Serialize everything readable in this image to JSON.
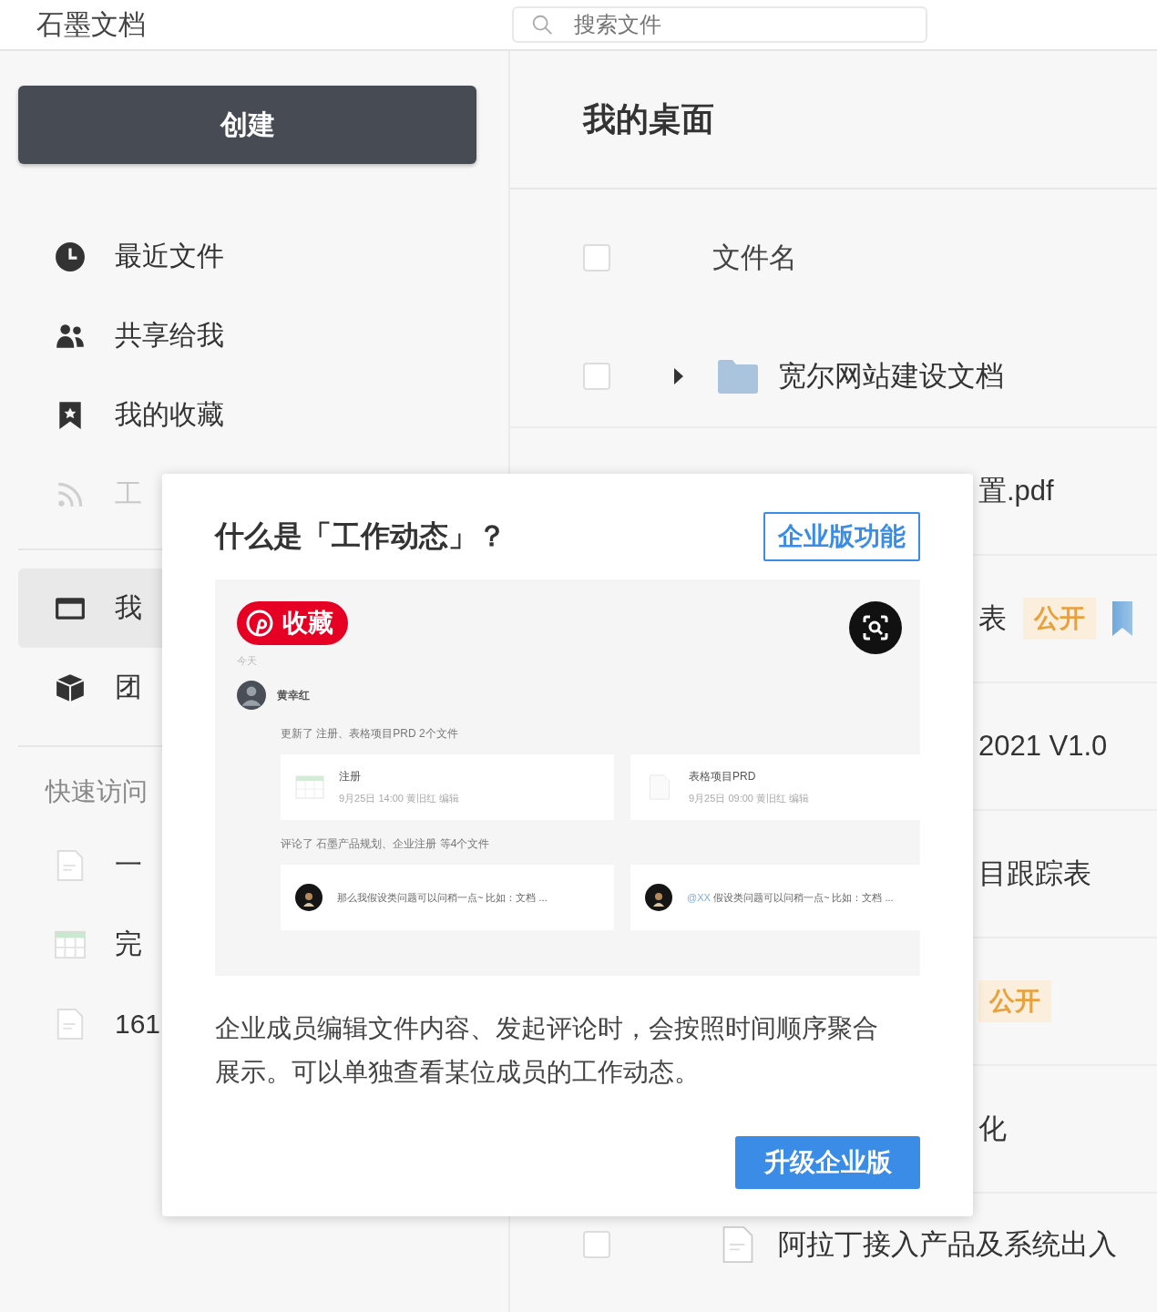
{
  "header": {
    "logo": "石墨文档",
    "search": {
      "placeholder": "搜索文件"
    }
  },
  "sidebar": {
    "create_button": "创建",
    "nav": [
      {
        "kind": "clock",
        "label": "最近文件",
        "selected": false,
        "disabled": false
      },
      {
        "kind": "people",
        "label": "共享给我",
        "selected": false,
        "disabled": false
      },
      {
        "kind": "bookmark",
        "label": "我的收藏",
        "selected": false,
        "disabled": false
      },
      {
        "kind": "feed",
        "label": "工",
        "selected": false,
        "disabled": true
      }
    ],
    "nav2": [
      {
        "kind": "desktop",
        "label": "我",
        "selected": true,
        "disabled": false
      },
      {
        "kind": "cube",
        "label": "团",
        "selected": false,
        "disabled": false
      }
    ],
    "quick_access": {
      "title": "快速访问",
      "items": [
        {
          "kind": "doc",
          "label": "一"
        },
        {
          "kind": "sheet",
          "label": "完"
        },
        {
          "kind": "doc",
          "label": "161"
        }
      ]
    }
  },
  "main": {
    "title": "我的桌面",
    "header": {
      "checked": false,
      "label": "文件名"
    },
    "rows": [
      {
        "kind": "folder",
        "checked": false,
        "expandable": true,
        "name": "宽尔网站建设文档"
      },
      {
        "kind": "partial",
        "name": "置.pdf"
      },
      {
        "kind": "partial",
        "name": "表",
        "tag": "公开",
        "starred": true
      },
      {
        "kind": "partial",
        "name": "2021 V1.0"
      },
      {
        "kind": "partial",
        "name": "目跟踪表"
      },
      {
        "kind": "partial",
        "tag": "公开"
      },
      {
        "kind": "partial",
        "name": "化"
      },
      {
        "kind": "doc",
        "checked": false,
        "expandable": false,
        "name": "阿拉丁接入产品及系统出入"
      }
    ]
  },
  "dialog": {
    "title": "什么是「工作动态」？",
    "badge": "企业版功能",
    "preview": {
      "pin_button": "收藏",
      "day": "今天",
      "user": "黄幸红",
      "groups": [
        {
          "summary": "更新了  注册、表格项目PRD  2个文件",
          "cards": [
            {
              "kind": "sheet",
              "title": "注册",
              "meta": "9月25日 14:00 黄旧红 编辑"
            },
            {
              "kind": "doc",
              "title": "表格项目PRD",
              "meta": "9月25日 09:00 黄旧红 编辑"
            }
          ]
        },
        {
          "summary": "评论了  石墨产品规划、企业注册  等4个文件",
          "cards": [
            {
              "kind": "comment",
              "text": "那么我假设类问题可以问稍一点~ 比如：文档 ..."
            },
            {
              "kind": "comment",
              "mention": "@XX",
              "text": "假设类问题可以问稍一点~ 比如：文档 ..."
            }
          ]
        }
      ]
    },
    "description": "企业成员编辑文件内容、发起评论时，会按照时间顺序聚合展示。可以单独查看某位成员的工作动态。",
    "upgrade_button": "升级企业版"
  }
}
